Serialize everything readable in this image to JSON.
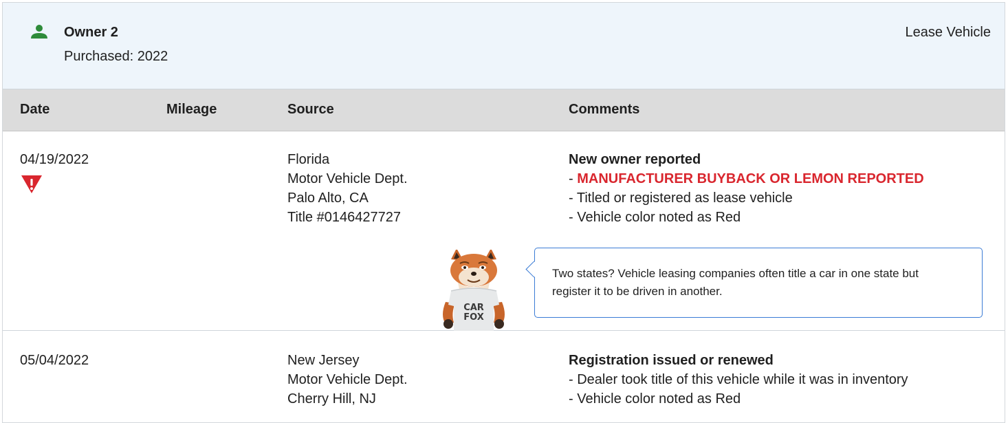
{
  "owner": {
    "title": "Owner 2",
    "purchased": "Purchased: 2022",
    "type": "Lease Vehicle",
    "icon": "person-icon",
    "icon_color": "#2e8b3a"
  },
  "columns": {
    "date": "Date",
    "mileage": "Mileage",
    "source": "Source",
    "comments": "Comments"
  },
  "records": [
    {
      "date": "04/19/2022",
      "mileage": "",
      "alert_icon": "warning-triangle-icon",
      "source": [
        "Florida",
        "Motor Vehicle Dept.",
        "Palo Alto, CA",
        "Title #0146427727"
      ],
      "comment_title": "New owner reported",
      "comment_alert": "MANUFACTURER BUYBACK OR LEMON REPORTED",
      "comment_items": [
        "- Titled or registered as lease vehicle",
        "- Vehicle color noted as Red"
      ],
      "tip": "Two states? Vehicle leasing companies often title a car in one state but register it to be driven in another.",
      "mascot_shirt": [
        "CAR",
        "FOX"
      ]
    },
    {
      "date": "05/04/2022",
      "mileage": "",
      "source": [
        "New Jersey",
        "Motor Vehicle Dept.",
        "Cherry Hill, NJ"
      ],
      "comment_title": "Registration issued or renewed",
      "comment_items": [
        "- Dealer took title of this vehicle while it was in inventory",
        "- Vehicle color noted as Red"
      ]
    }
  ],
  "colors": {
    "header_bg": "#eef5fb",
    "column_bar_bg": "#dcdcdc",
    "alert_red": "#d9262e",
    "tip_border": "#3a7bd5"
  }
}
